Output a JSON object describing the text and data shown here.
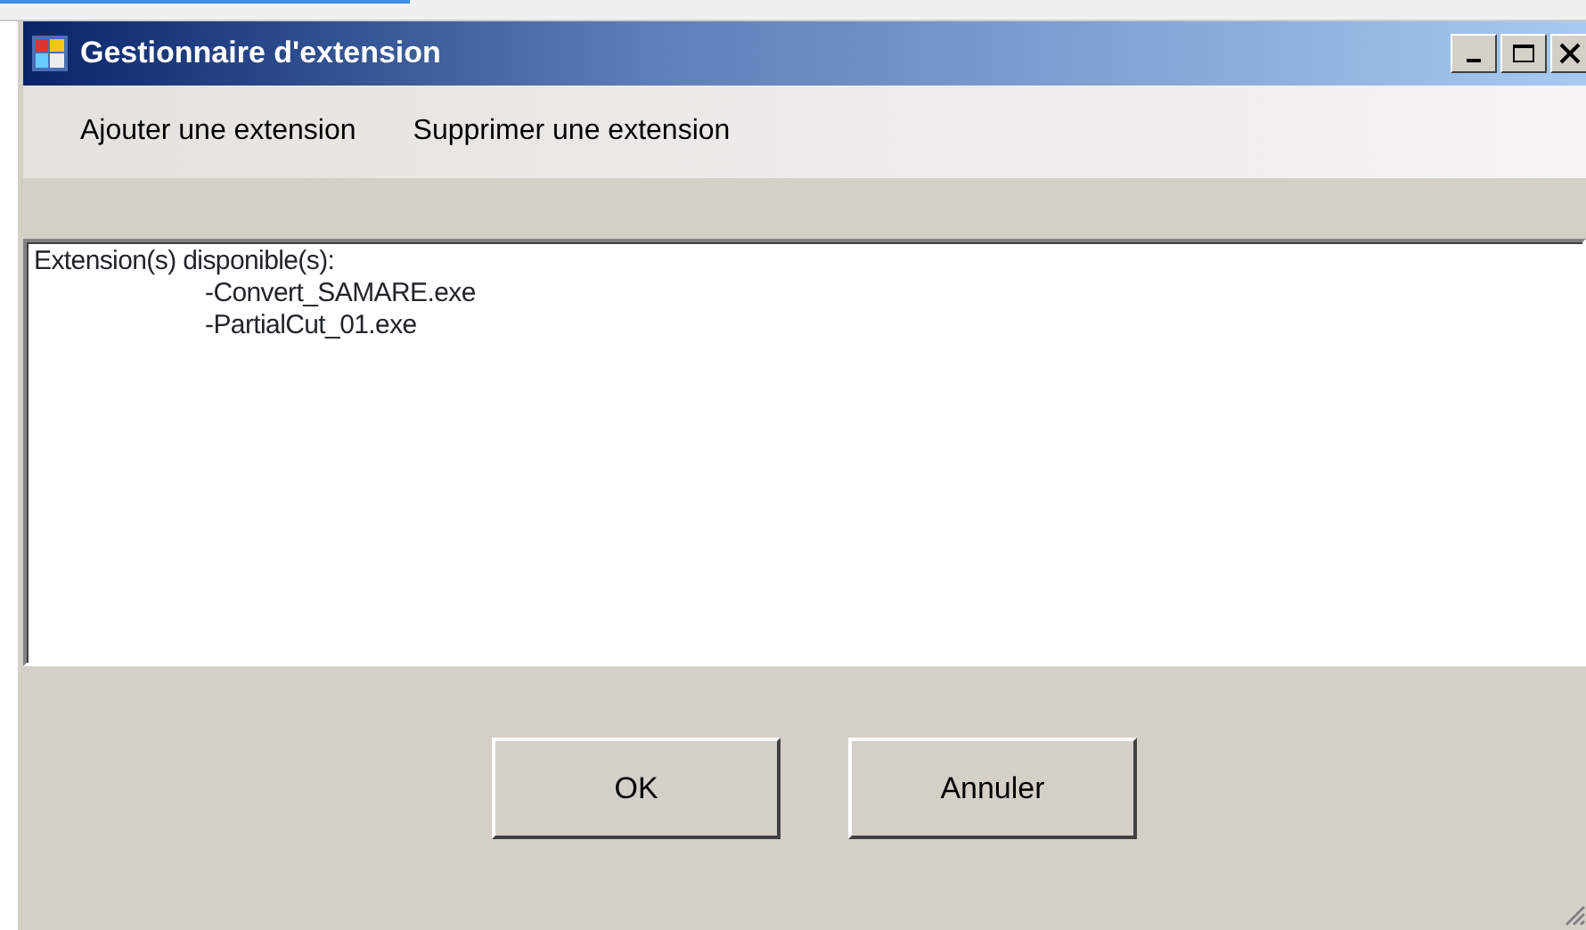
{
  "window": {
    "title": "Gestionnaire d'extension"
  },
  "menu": [
    "Ajouter une extension",
    "Supprimer une extension"
  ],
  "text_box": {
    "heading": "Extension(s) disponible(s):",
    "items": [
      "-Convert_SAMARE.exe",
      "-PartialCut_01.exe"
    ]
  },
  "buttons": [
    "OK",
    "Annuler"
  ]
}
